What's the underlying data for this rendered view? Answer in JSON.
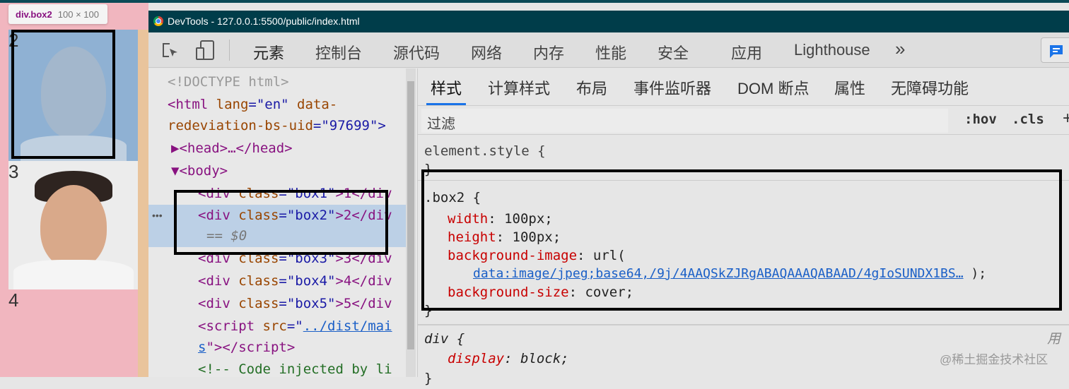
{
  "page": {
    "tooltip": {
      "selector": "div.box2",
      "size": "100 × 100"
    },
    "boxes": [
      {
        "label": "2"
      },
      {
        "label": "3"
      },
      {
        "label": "4"
      }
    ]
  },
  "devtools": {
    "title": "DevTools - 127.0.0.1:5500/public/index.html",
    "tabs": [
      "元素",
      "控制台",
      "源代码",
      "网络",
      "内存",
      "性能",
      "安全",
      "应用",
      "Lighthouse",
      "»"
    ],
    "elements": {
      "lines": [
        {
          "t": "<!DOCTYPE html>"
        },
        {
          "a": "<html ",
          "b": "lang",
          "c": "=\"en\" ",
          "d": "data-"
        },
        {
          "a": "redeviation-bs-uid",
          "c": "=\"97699\">"
        },
        {
          "a": "▶<head>…</head>"
        },
        {
          "a": "▼<body>"
        },
        {
          "a": "<div ",
          "b": "class",
          "c": "=\"box1\"",
          ">": ">1</div"
        },
        {
          "a": "<div ",
          "b": "class",
          "c": "=\"box2\"",
          ">": ">2</div"
        },
        {
          "t": "== $0"
        },
        {
          "a": "<div ",
          "b": "class",
          "c": "=\"box3\"",
          ">": ">3</div"
        },
        {
          "a": "<div ",
          "b": "class",
          "c": "=\"box4\"",
          ">": ">4</div"
        },
        {
          "a": "<div ",
          "b": "class",
          "c": "=\"box5\"",
          ">": ">5</div"
        },
        {
          "a": "<script ",
          "b": "src",
          "c": "=\"",
          "l": "../dist/mai"
        },
        {
          "l": "s",
          "c": "\"></script>"
        },
        {
          "t": "<!-- Code injected by li"
        }
      ],
      "dots": "•••"
    },
    "styles": {
      "tabs": [
        "样式",
        "计算样式",
        "布局",
        "事件监听器",
        "DOM 断点",
        "属性",
        "无障碍功能"
      ],
      "filter_placeholder": "过滤",
      "hov": ":hov",
      "cls": ".cls",
      "plus": "+",
      "element_style": "element.style {",
      "close": "}",
      "box2_selector": ".box2 {",
      "rules": [
        {
          "p": "width",
          "v": "100px;"
        },
        {
          "p": "height",
          "v": "100px;"
        },
        {
          "p": "background-image",
          "v": "url("
        },
        {
          "p": "background-size",
          "v": "cover;"
        }
      ],
      "url_link": "data:image/jpeg;base64,/9j/4AAQSkZJRgABAQAAAQABAAD/4gIoSUNDX1BS…",
      "url_end": ");",
      "div_selector": "div {",
      "div_prop": "display",
      "div_val": "block;",
      "ua": "用",
      "watermark": "@稀土掘金技术社区"
    }
  }
}
